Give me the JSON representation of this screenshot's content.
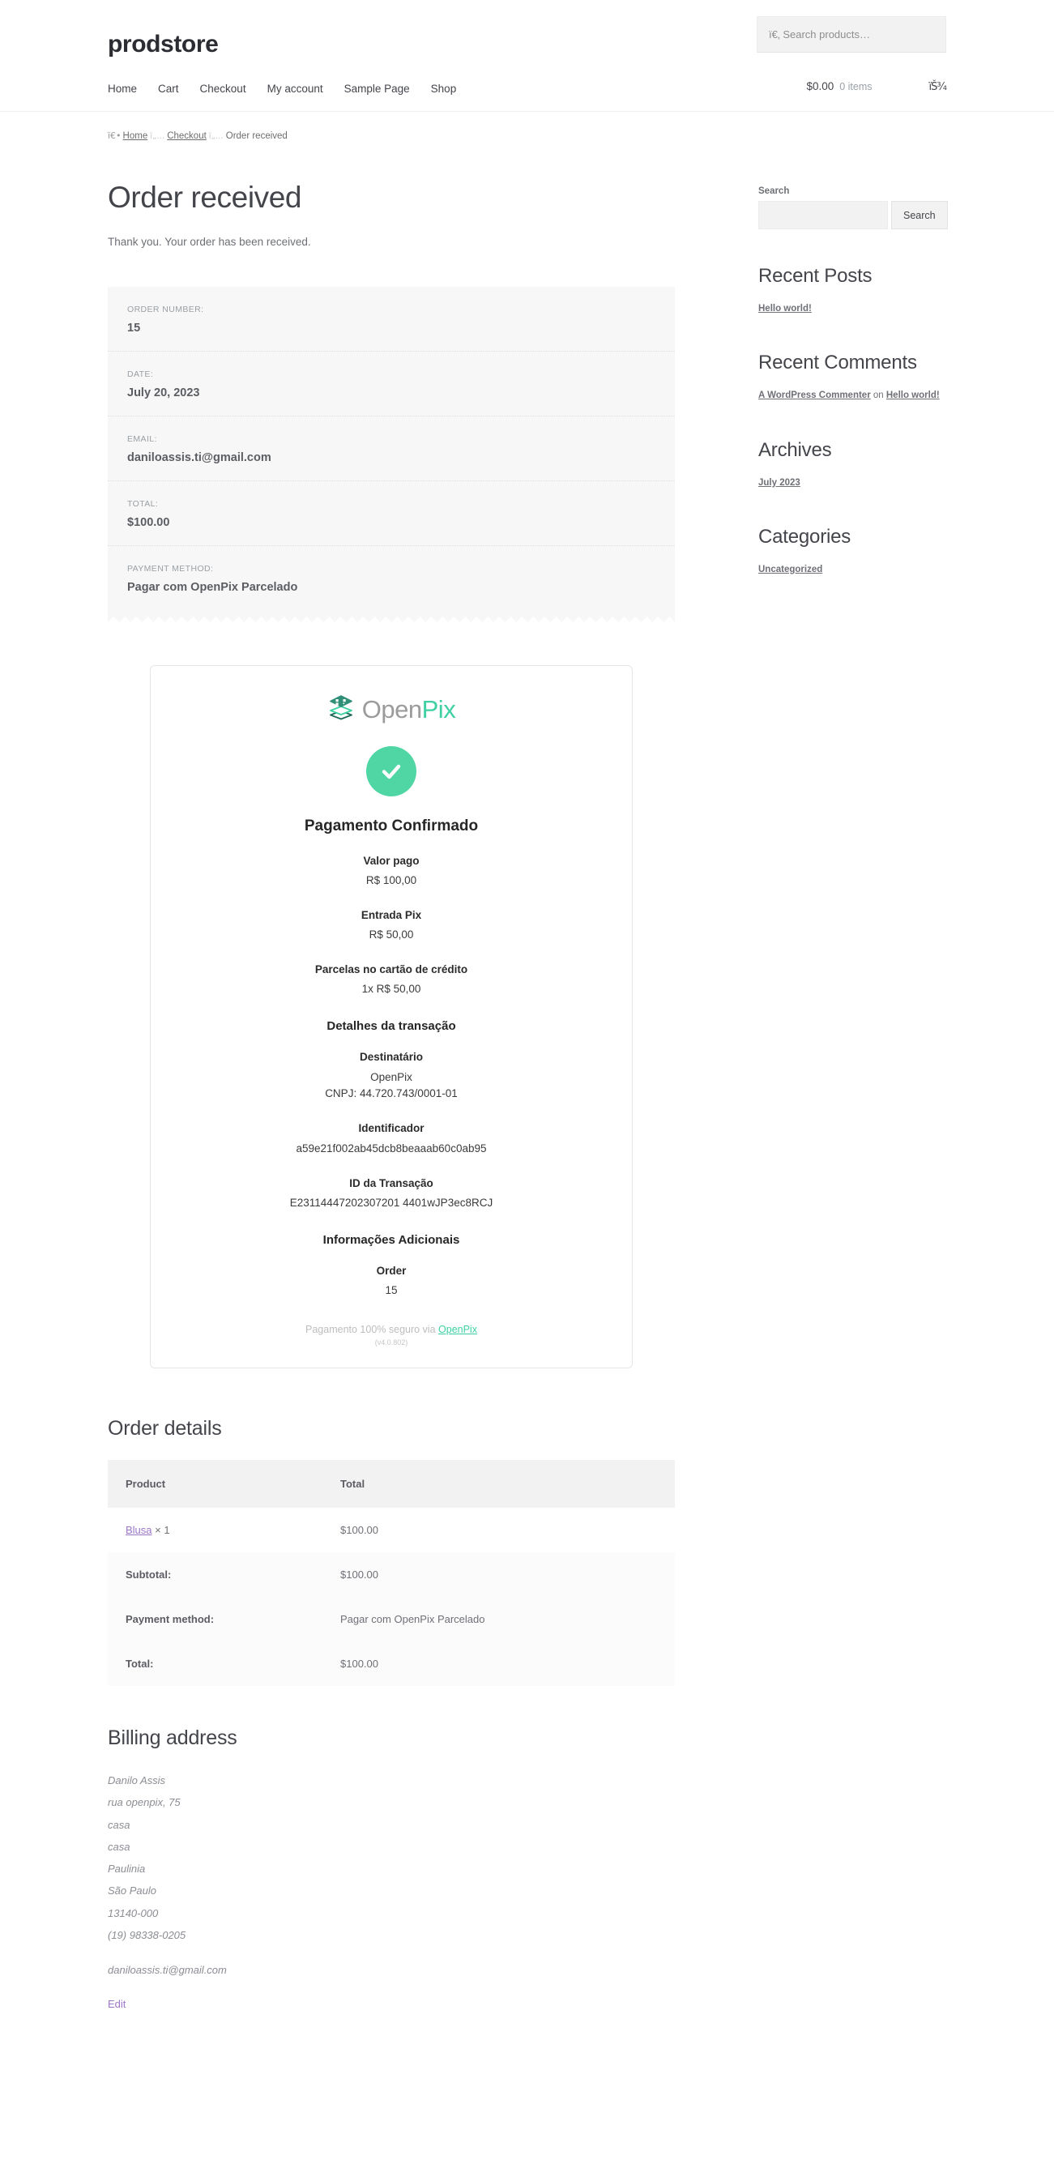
{
  "header": {
    "brand": "prodstore",
    "search_placeholder": "ï€‚ Search products…",
    "nav": [
      {
        "label": "Home"
      },
      {
        "label": "Cart"
      },
      {
        "label": "Checkout"
      },
      {
        "label": "My account"
      },
      {
        "label": "Sample Page"
      },
      {
        "label": "Shop"
      }
    ],
    "cart_amount": "$0.00",
    "cart_count": "0 items",
    "cart_glyph": "ïŠ¾"
  },
  "breadcrumb": {
    "home_icon": "ï€•",
    "home": "Home",
    "sep": "ï„…",
    "checkout": "Checkout",
    "current": "Order received"
  },
  "main": {
    "title": "Order received",
    "thankyou": "Thank you. Your order has been received.",
    "overview": [
      {
        "label": "ORDER NUMBER:",
        "value": "15"
      },
      {
        "label": "DATE:",
        "value": "July 20, 2023"
      },
      {
        "label": "EMAIL:",
        "value": "daniloassis.ti@gmail.com"
      },
      {
        "label": "TOTAL:",
        "value": "$100.00"
      },
      {
        "label": "PAYMENT METHOD:",
        "value": "Pagar com OpenPix Parcelado"
      }
    ]
  },
  "openpix": {
    "logo_open": "Open",
    "logo_pix": "Pix",
    "status": "Pagamento Confirmado",
    "groups": [
      {
        "key": "Valor pago",
        "value": "R$ 100,00"
      },
      {
        "key": "Entrada Pix",
        "value": "R$ 50,00"
      },
      {
        "key": "Parcelas no cartão de crédito",
        "value": "1x R$ 50,00"
      }
    ],
    "tx_section_title": "Detalhes da transação",
    "tx_groups": [
      {
        "key": "Destinatário",
        "value": "OpenPix",
        "value2": "CNPJ: 44.720.743/0001-01"
      },
      {
        "key": "Identificador",
        "value": "a59e21f002ab45dcb8beaaab60c0ab95",
        "value2": ""
      },
      {
        "key": "ID da Transação",
        "value": "E23114447202307201 4401wJP3ec8RCJ",
        "value2": ""
      }
    ],
    "extra_section_title": "Informações Adicionais",
    "extra_key": "Order",
    "extra_value": "15",
    "secure_prefix": "Pagamento 100% seguro via ",
    "secure_brand": "OpenPix",
    "version": "(v4.0.802)"
  },
  "order_details": {
    "title": "Order details",
    "columns": [
      "Product",
      "Total"
    ],
    "rows": [
      {
        "product": "Blusa",
        "qty": "× 1",
        "total": "$100.00"
      }
    ],
    "footer": [
      {
        "label": "Subtotal:",
        "value": "$100.00"
      },
      {
        "label": "Payment method:",
        "value": "Pagar com OpenPix Parcelado"
      },
      {
        "label": "Total:",
        "value": "$100.00"
      }
    ]
  },
  "billing": {
    "title": "Billing address",
    "lines": [
      "Danilo Assis",
      "rua openpix, 75",
      "casa",
      "casa",
      "Paulinia",
      "São Paulo",
      "13140-000",
      "(19) 98338-0205"
    ],
    "email": "daniloassis.ti@gmail.com",
    "edit_label": "Edit"
  },
  "sidebar": {
    "search": {
      "label": "Search",
      "value": "",
      "button": "Search"
    },
    "recent_posts": {
      "title": "Recent Posts",
      "items": [
        "Hello world!"
      ]
    },
    "recent_comments": {
      "title": "Recent Comments",
      "author": "A WordPress Commenter",
      "on": " on ",
      "post": "Hello world!"
    },
    "archives": {
      "title": "Archives",
      "items": [
        "July 2023"
      ]
    },
    "categories": {
      "title": "Categories",
      "items": [
        "Uncategorized"
      ]
    }
  },
  "colors": {
    "accent_green": "#4fd6a4",
    "pix_teal": "#3ed0a3",
    "link_purple": "#9b76c7",
    "panel_gray": "#f7f7f7"
  }
}
